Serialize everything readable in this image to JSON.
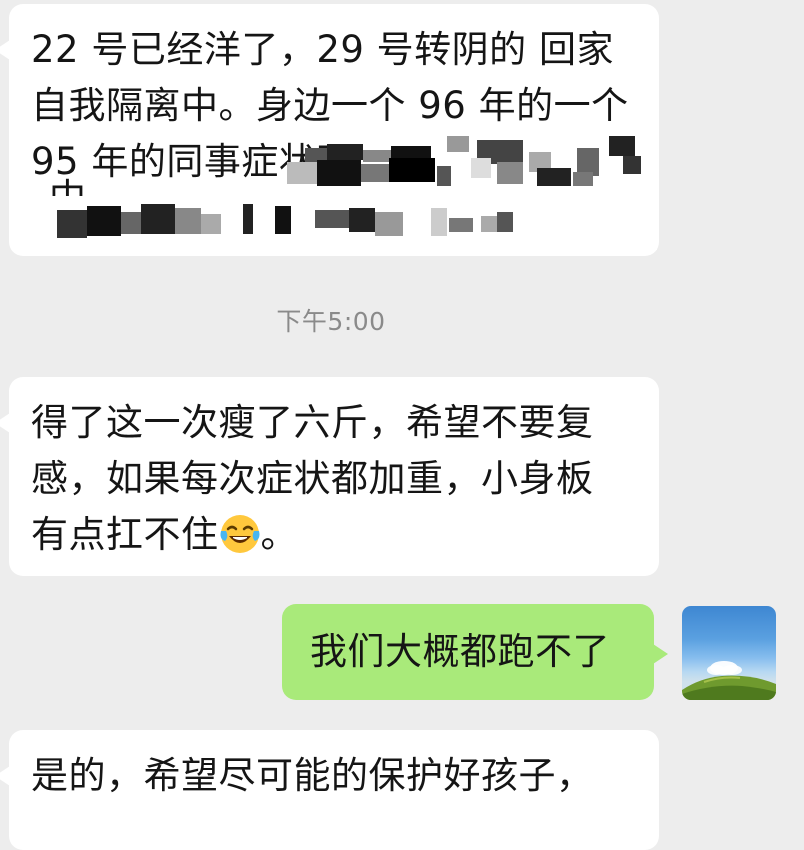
{
  "messages": [
    {
      "id": "msg1",
      "direction": "incoming",
      "lines": [
        "22 号已经洋了，29 号转阴的 回家",
        "自我隔离中。身边一个 96 年的一个",
        "95 年的同事症状不"
      ],
      "partially_visible": "中"
    },
    {
      "id": "msg2",
      "direction": "incoming",
      "lines": [
        "得了这一次瘦了六斤，希望不要复",
        "感，如果每次症状都加重，小身板",
        "有点扛不住"
      ],
      "end_emoji": "laughing-crying-emoji",
      "tail_text": "。"
    },
    {
      "id": "msg3",
      "direction": "outgoing",
      "text": "我们大概都跑不了"
    },
    {
      "id": "msg4",
      "direction": "incoming",
      "lines": [
        "是的，希望尽可能的保护好孩子，"
      ]
    }
  ],
  "timestamp": "下午5:00",
  "colors": {
    "background": "#ededed",
    "incoming_bubble": "#ffffff",
    "outgoing_bubble": "#a9ea7a",
    "timestamp_text": "#8a8a8a"
  },
  "avatar": {
    "icon": "landscape-avatar-icon"
  }
}
